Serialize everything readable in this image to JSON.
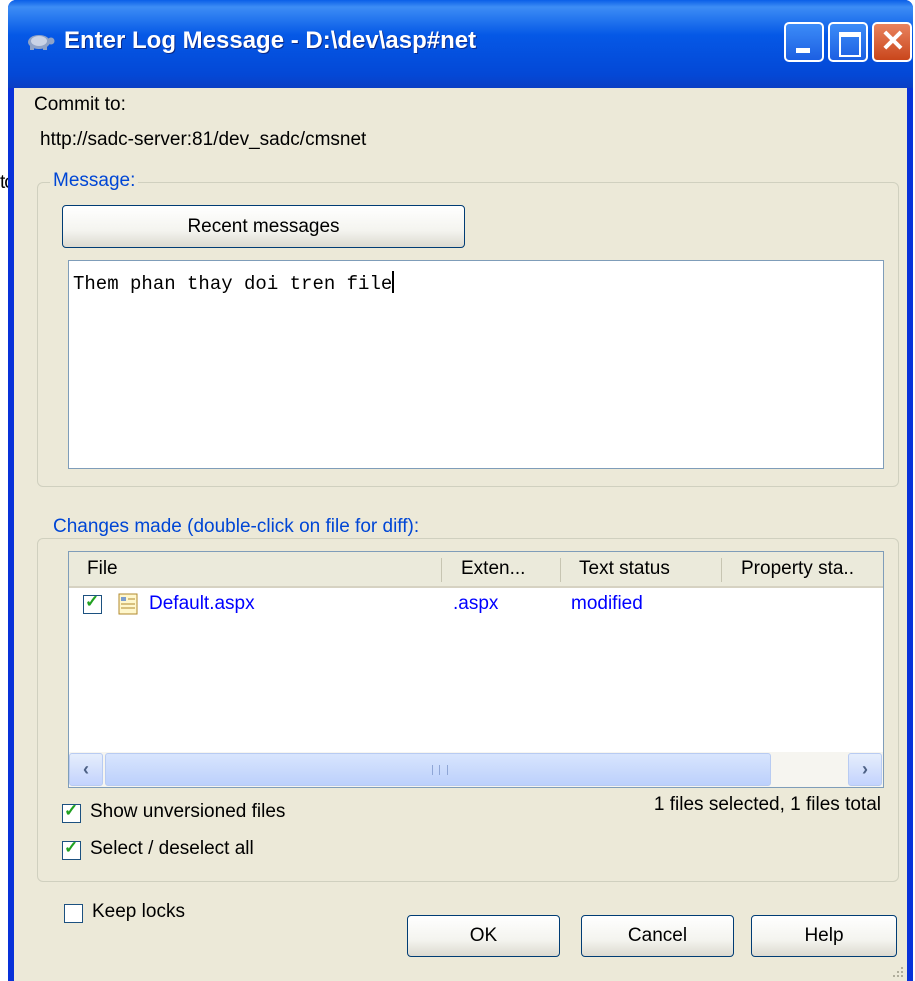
{
  "window": {
    "title": "Enter Log Message - D:\\dev\\asp#net"
  },
  "background_fragment": "to",
  "commit": {
    "label": "Commit to:",
    "url": "http://sadc-server:81/dev_sadc/cmsnet"
  },
  "message_group": {
    "legend": "Message:",
    "recent_button": "Recent messages",
    "text": "Them phan thay doi tren file"
  },
  "changes_group": {
    "legend": "Changes made (double-click on file for diff):",
    "columns": [
      "File",
      "Exten...",
      "Text status",
      "Property sta.."
    ],
    "rows": [
      {
        "file": "Default.aspx",
        "extension": ".aspx",
        "text_status": "modified",
        "property_status": "",
        "checked": true
      }
    ],
    "show_unversioned": "Show unversioned files",
    "select_all": "Select / deselect all",
    "summary": "1 files selected, 1 files total"
  },
  "keep_locks": "Keep locks",
  "buttons": {
    "ok": "OK",
    "cancel": "Cancel",
    "help": "Help"
  },
  "colors": {
    "title_bar": "#0558e6",
    "dialog_face": "#ece9d8",
    "group_legend": "#0046d5",
    "item_text": "#0000ff"
  }
}
